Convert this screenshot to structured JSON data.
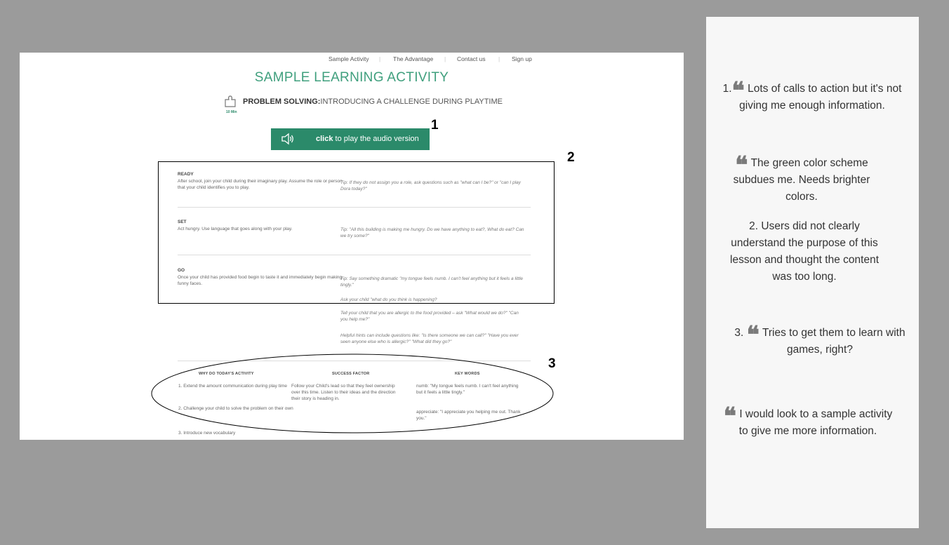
{
  "nav": {
    "items": [
      "Sample Activity",
      "The Advantage",
      "Contact us",
      "Sign up"
    ]
  },
  "page": {
    "title": "SAMPLE LEARNING ACTIVITY",
    "subtitle_bold": "PROBLEM SOLVING:",
    "subtitle_rest": "INTRODUCING A CHALLENGE DURING PLAYTIME",
    "duration": "10 Min"
  },
  "audio": {
    "bold": "click",
    "rest": " to play the audio version"
  },
  "steps": [
    {
      "heading": "READY",
      "text": "After school, join your child during their imaginary play. Assume the role or person that your child identifies you to play.",
      "tips": [
        "Tip: If they do not assign you a role, ask questions such as \"what can I be?\" or \"can I play Dora today?\""
      ]
    },
    {
      "heading": "SET",
      "text": "Act hungry. Use language that goes along with your play.",
      "tips": [
        "Tip: \"All this building is making me hungry. Do we have anything to eat?, What do eat? Can we try some?\""
      ]
    },
    {
      "heading": "GO",
      "text": "Once your child has provided food begin to taste it and immediately begin making funny faces.",
      "tips": [
        "Tip: Say something dramatic \"my tongue feels numb. I can't feel anything but it feels a little tingly.\"",
        "Ask your child \"what do you think is happening?",
        "Tell your child that you are allergic to the food provided – ask \"What would we do?\" \"Can you help me?\"",
        "Helpful hints can include questions like: \"Is there someone we can call?\" \"Have you ever seen anyone else who is allergic?\" \"What did they go?\""
      ]
    }
  ],
  "columns": {
    "why": {
      "heading": "WHY DO TODAY'S ACTIVITY",
      "items": [
        "1.  Extend the amount communication during play time",
        "2.  Challenge your child to solve the problem on their own",
        "3.  Introduce new vocabulary"
      ]
    },
    "success": {
      "heading": "SUCCESS FACTOR",
      "text": "Follow your Child's lead so that they feel ownership over this time. Listen to their ideas and the direction their story is heading in."
    },
    "keywords": {
      "heading": "KEY WORDS",
      "items": [
        "numb: \"My tongue feels numb. I can't feel anything but it feels a little tingly.\"",
        "appreciate: \"I appreciate you helping me out. Thank you.\""
      ]
    }
  },
  "annotations": {
    "one": "1",
    "two": "2",
    "three": "3"
  },
  "notes": [
    {
      "prefix": "1.",
      "quote": "❝",
      "text": "Lots of calls to action but it's not giving me enough information."
    },
    {
      "prefix": "",
      "quote": "❝",
      "text": "The green color scheme subdues me. Needs brighter colors."
    },
    {
      "prefix": "",
      "quote": "",
      "text": "2. Users did not clearly understand the purpose of this lesson and thought the content was too long."
    },
    {
      "prefix": "3.",
      "quote": "❝",
      "text": "Tries to get them to learn with games, right?"
    },
    {
      "prefix": "",
      "quote": "❝",
      "text": "I would look to a sample activity to give me more information."
    }
  ],
  "colors": {
    "brand_green": "#2b8a6a",
    "title_green": "#3f9f7d",
    "backdrop": "#9b9b9b"
  }
}
